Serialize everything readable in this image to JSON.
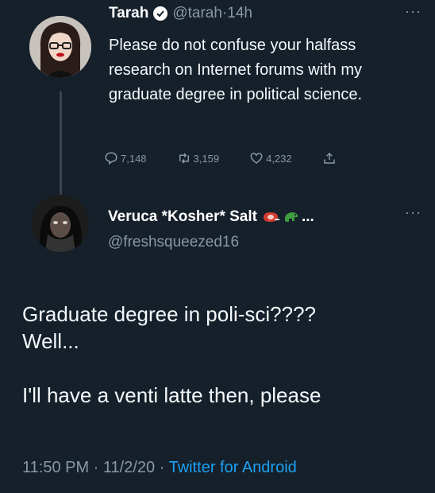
{
  "original_tweet": {
    "display_name": "Tarah",
    "handle": "@tarah",
    "separator": "·",
    "time": "14h",
    "text": "Please do not confuse your halfass research on Internet forums with my graduate degree in political science.",
    "actions": {
      "replies": "7,148",
      "retweets": "3,159",
      "likes": "4,232"
    },
    "icons": [
      "verified-badge-icon",
      "more-icon",
      "reply-icon",
      "retweet-icon",
      "like-icon",
      "share-icon"
    ]
  },
  "reply_tweet": {
    "display_name": "Veruca *Kosher* Salt",
    "name_suffix": "...",
    "handle": "@freshsqueezed16",
    "lines": {
      "line1": "Graduate degree in poli-sci????",
      "line2": "Well...",
      "line3": "I'll have a venti latte then, please"
    },
    "icons": [
      "steak-emoji-icon",
      "dinosaur-emoji-icon",
      "more-icon"
    ],
    "footer": {
      "time": "11:50 PM",
      "sep1": " · ",
      "date": "11/2/20",
      "sep2": " · ",
      "source": "Twitter for Android"
    }
  },
  "colors": {
    "background": "#15202b",
    "text": "#ffffff",
    "secondary_text": "#8899a6",
    "link": "#1da1f2",
    "thread_line": "#38444d"
  }
}
